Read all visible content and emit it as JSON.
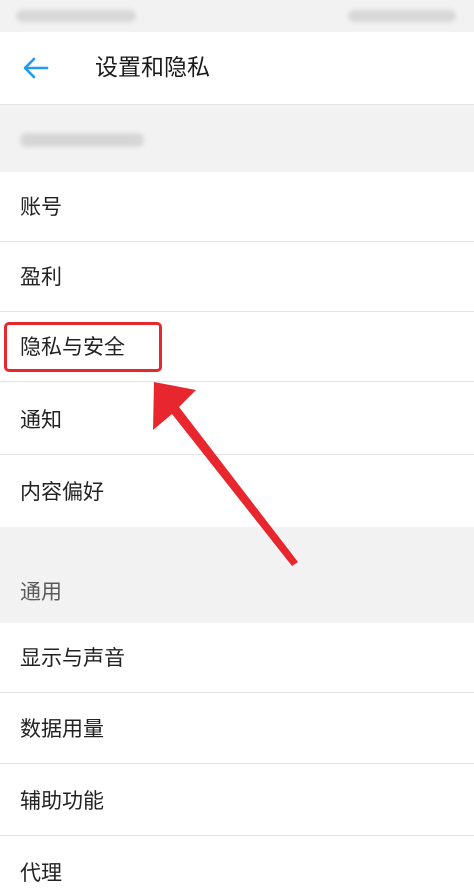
{
  "header": {
    "title": "设置和隐私",
    "back_icon": "back-arrow-icon"
  },
  "menu": {
    "items": [
      {
        "label": "账号"
      },
      {
        "label": "盈利"
      },
      {
        "label": "隐私与安全"
      },
      {
        "label": "通知"
      },
      {
        "label": "内容偏好"
      }
    ]
  },
  "general": {
    "section_label": "通用",
    "items": [
      {
        "label": "显示与声音"
      },
      {
        "label": "数据用量"
      },
      {
        "label": "辅助功能"
      },
      {
        "label": "代理"
      }
    ]
  },
  "colors": {
    "accent": "#1d9bf0",
    "annotation": "#e8262e",
    "divider": "#e3e3e3",
    "section_bg": "#f2f2f2"
  }
}
